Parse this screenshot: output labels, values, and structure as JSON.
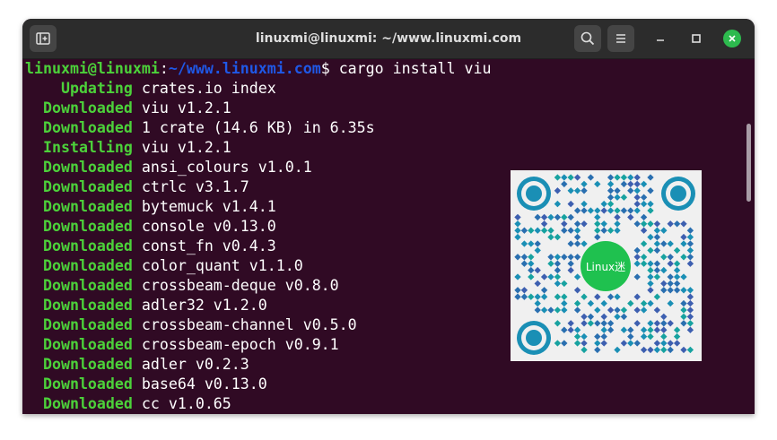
{
  "window": {
    "title": "linuxmi@linuxmi: ~/www.linuxmi.com"
  },
  "titlebar_icons": {
    "new_tab": "new-tab-icon",
    "search": "search-icon",
    "menu": "hamburger-menu-icon",
    "minimize": "minimize-icon",
    "maximize": "maximize-icon",
    "close": "close-icon"
  },
  "prompt": {
    "user_host": "linuxmi@linuxmi",
    "separator": ":",
    "path": "~/www.linuxmi.com",
    "symbol": "$",
    "command": " cargo install viu"
  },
  "output": [
    {
      "status": "    Updating",
      "text": " crates.io index"
    },
    {
      "status": "  Downloaded",
      "text": " viu v1.2.1"
    },
    {
      "status": "  Downloaded",
      "text": " 1 crate (14.6 KB) in 6.35s"
    },
    {
      "status": "  Installing",
      "text": " viu v1.2.1"
    },
    {
      "status": "  Downloaded",
      "text": " ansi_colours v1.0.1"
    },
    {
      "status": "  Downloaded",
      "text": " ctrlc v3.1.7"
    },
    {
      "status": "  Downloaded",
      "text": " bytemuck v1.4.1"
    },
    {
      "status": "  Downloaded",
      "text": " console v0.13.0"
    },
    {
      "status": "  Downloaded",
      "text": " const_fn v0.4.3"
    },
    {
      "status": "  Downloaded",
      "text": " color_quant v1.1.0"
    },
    {
      "status": "  Downloaded",
      "text": " crossbeam-deque v0.8.0"
    },
    {
      "status": "  Downloaded",
      "text": " adler32 v1.2.0"
    },
    {
      "status": "  Downloaded",
      "text": " crossbeam-channel v0.5.0"
    },
    {
      "status": "  Downloaded",
      "text": " crossbeam-epoch v0.9.1"
    },
    {
      "status": "  Downloaded",
      "text": " adler v0.2.3"
    },
    {
      "status": "  Downloaded",
      "text": " base64 v0.13.0"
    },
    {
      "status": "  Downloaded",
      "text": " cc v1.0.65"
    }
  ],
  "qr_overlay": {
    "logo_text": "Linux迷"
  },
  "colors": {
    "terminal_bg": "#300a24",
    "status_green": "#4cd13a",
    "path_blue": "#1f58e6",
    "close_green": "#2dba4e"
  }
}
